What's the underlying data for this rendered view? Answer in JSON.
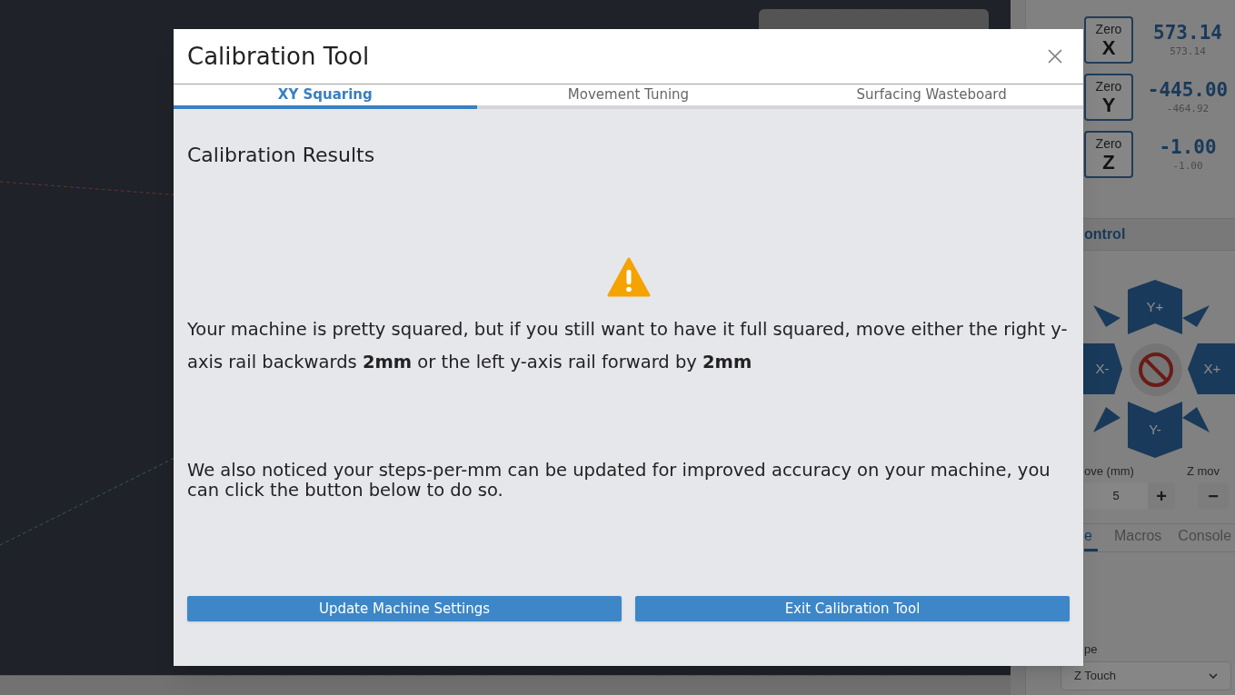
{
  "side_panel": {
    "dro": [
      {
        "caption": "Zero",
        "axis": "X",
        "value": "573.14",
        "machine_value": "573.14"
      },
      {
        "caption": "Zero",
        "axis": "Y",
        "value": "-445.00",
        "machine_value": "-464.92"
      },
      {
        "caption": "Zero",
        "axis": "Z",
        "value": "-1.00",
        "machine_value": "-1.00"
      }
    ],
    "section_title": "ontrol",
    "jog": {
      "y_plus": "Y+",
      "x_minus": "X-",
      "x_plus": "X+",
      "y_minus": "Y-"
    },
    "xy_move_label": "ove (mm)",
    "xy_move_value": "5",
    "plus": "+",
    "z_move_label": "Z mov",
    "minus": "−",
    "tabs": [
      {
        "label": "e",
        "selected": true
      },
      {
        "label": "Macros",
        "selected": false
      },
      {
        "label": "Console",
        "selected": false
      }
    ],
    "probe_label": "pe",
    "probe_select": "Z Touch"
  },
  "modal": {
    "title": "Calibration Tool",
    "tabs": [
      {
        "label": "XY Squaring",
        "selected": true
      },
      {
        "label": "Movement Tuning",
        "selected": false
      },
      {
        "label": "Surfacing Wasteboard",
        "selected": false
      }
    ],
    "heading": "Calibration Results",
    "message": "Your machine is pretty squared, but if you still want to have it full squared, move either the right y-axis rail backwards **2mm** or the left y-axis rail forward by **2mm**",
    "note": "We also noticed your steps-per-mm can be updated for improved accuracy on your machine, you can click the button below to do so.",
    "buttons": [
      "Update Machine Settings",
      "Exit Calibration Tool"
    ]
  }
}
